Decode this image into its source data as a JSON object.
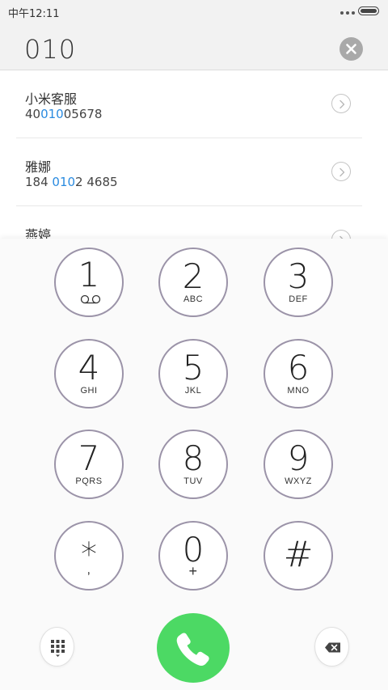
{
  "status_bar": {
    "time": "中午12:11"
  },
  "dialer": {
    "number": "010"
  },
  "contacts": [
    {
      "name": "小米客服",
      "number_pre": "40",
      "number_match": "010",
      "number_post": "05678"
    },
    {
      "name": "雅娜",
      "number_pre": "184 ",
      "number_match": "010",
      "number_post": "2 4685"
    },
    {
      "name": "燕婷",
      "number_pre": "",
      "number_match": "",
      "number_post": ""
    }
  ],
  "keys": [
    {
      "digit": "1",
      "letters": ""
    },
    {
      "digit": "2",
      "letters": "ABC"
    },
    {
      "digit": "3",
      "letters": "DEF"
    },
    {
      "digit": "4",
      "letters": "GHI"
    },
    {
      "digit": "5",
      "letters": "JKL"
    },
    {
      "digit": "6",
      "letters": "MNO"
    },
    {
      "digit": "7",
      "letters": "PQRS"
    },
    {
      "digit": "8",
      "letters": "TUV"
    },
    {
      "digit": "9",
      "letters": "WXYZ"
    },
    {
      "digit": "*",
      "letters": ","
    },
    {
      "digit": "0",
      "letters": "+"
    },
    {
      "digit": "#",
      "letters": ""
    }
  ],
  "icons": {
    "voicemail": "voicemail-icon",
    "clear": "clear-icon",
    "detail": "chevron-right-icon",
    "keypad_toggle": "keypad-icon",
    "call": "phone-icon",
    "backspace": "backspace-icon"
  },
  "colors": {
    "highlight": "#2a8be0",
    "call_green": "#4cd964",
    "key_ring": "#9b93a8"
  }
}
